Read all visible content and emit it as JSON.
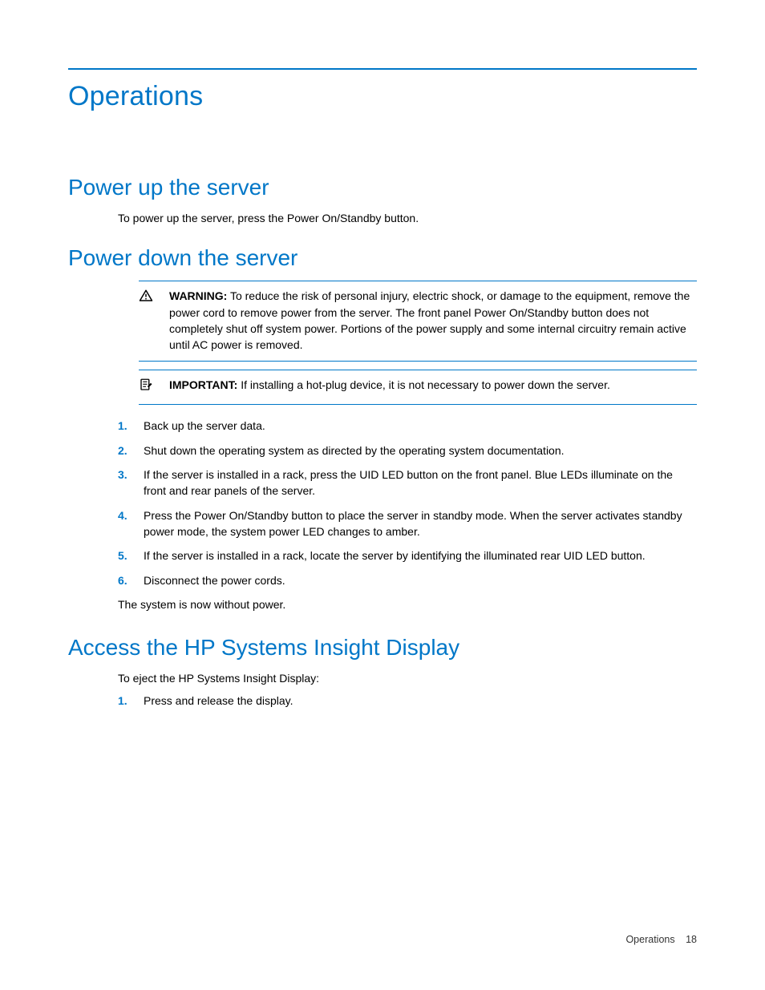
{
  "page_title": "Operations",
  "sections": {
    "power_up": {
      "heading": "Power up the server",
      "body": "To power up the server, press the Power On/Standby button."
    },
    "power_down": {
      "heading": "Power down the server",
      "warning": {
        "label": "WARNING:",
        "text": "To reduce the risk of personal injury, electric shock, or damage to the equipment, remove the power cord to remove power from the server. The front panel Power On/Standby button does not completely shut off system power. Portions of the power supply and some internal circuitry remain active until AC power is removed."
      },
      "important": {
        "label": "IMPORTANT:",
        "text": "If installing a hot-plug device, it is not necessary to power down the server."
      },
      "steps": [
        "Back up the server data.",
        "Shut down the operating system as directed by the operating system documentation.",
        "If the server is installed in a rack, press the UID LED button on the front panel. Blue LEDs illuminate on the front and rear panels of the server.",
        "Press the Power On/Standby button to place the server in standby mode. When the server activates standby power mode, the system power LED changes to amber.",
        "If the server is installed in a rack, locate the server by identifying the illuminated rear UID LED button.",
        "Disconnect the power cords."
      ],
      "after": "The system is now without power."
    },
    "insight": {
      "heading": "Access the HP Systems Insight Display",
      "body": "To eject the HP Systems Insight Display:",
      "steps": [
        "Press and release the display."
      ]
    }
  },
  "footer": {
    "section": "Operations",
    "page_number": "18"
  },
  "nums": {
    "n1": "1.",
    "n2": "2.",
    "n3": "3.",
    "n4": "4.",
    "n5": "5.",
    "n6": "6."
  }
}
